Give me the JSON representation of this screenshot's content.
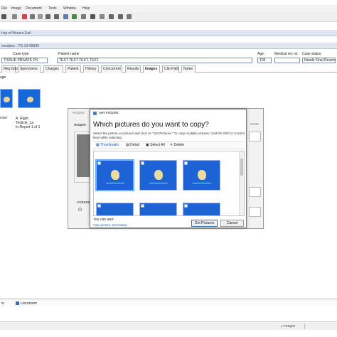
{
  "menubar": {
    "items": [
      "File",
      "Image",
      "Document",
      "Tools",
      "Window",
      "Help"
    ]
  },
  "windows": {
    "main_title": "hop of Horace Earl",
    "sub_title": "meadow - PS-19-99999"
  },
  "case": {
    "case_type_label": "Case type",
    "case_type_value": "TISSUE PRIVATE PS",
    "patient_label": "Patient name",
    "patient_value": "TEST TEST TEST, TEST",
    "age_label": "Age:",
    "age_value": "109",
    "medical_rec_label": "Medical rec no",
    "case_status_label": "Case status",
    "case_status_value": "Needs Final Review"
  },
  "tabs": [
    "Req Data",
    "Specimens",
    "Charges",
    "Patient",
    "History",
    "Concurrent",
    "Results",
    "Images",
    "Clin Path",
    "Notes"
  ],
  "active_tab": "Images",
  "image_section_label": "age",
  "image_thumbs": [
    {
      "caption": "cicle"
    },
    {
      "caption": "A. Right\nTesticle_La\nIn Report 1 of 1"
    }
  ],
  "acquire_dialog": {
    "title": "Acquire",
    "field_label": "Acquire",
    "pictures_label": "Pictures",
    "side_label": "ectlbi"
  },
  "dialog": {
    "title": "Get Pictures",
    "heading": "Which pictures do you want to copy?",
    "instructions": "Select the picture or pictures and click on \"Get Pictures.\" To copy multiple pictures, hold the Shift or Control keys while selecting.",
    "toolbar": [
      "Thumbnails",
      "Detail",
      "Select All",
      "Delete"
    ],
    "you_can_also": "You can also:",
    "view_info_link": "View picture information",
    "get_pictures_button": "Get Pictures",
    "cancel_button": "Cancel"
  },
  "bottom_tabs": [
    "ts",
    "Document"
  ],
  "status": {
    "image_count": "2 images"
  },
  "colors": {
    "picture_blue": "#1e63d6",
    "title_bar": "#dfe6f0",
    "accent": "#2b74c9"
  }
}
